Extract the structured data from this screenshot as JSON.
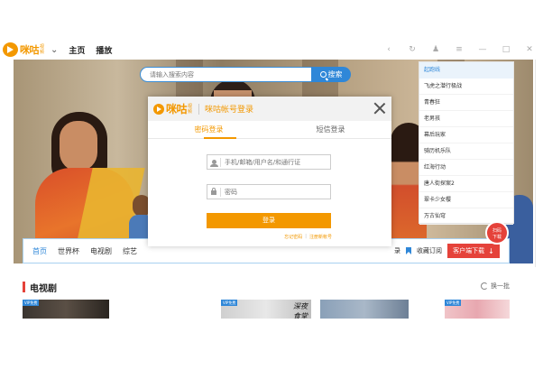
{
  "titlebar": {
    "logo_text": "咪咕",
    "logo_sub": "视频",
    "nav": [
      "主页",
      "播放"
    ],
    "icons": [
      "back-icon",
      "refresh-icon",
      "user-icon",
      "menu-icon",
      "minimize-icon",
      "maximize-icon",
      "close-icon"
    ]
  },
  "search": {
    "placeholder": "请输入搜索内容",
    "button_label": "搜索"
  },
  "rank_list": {
    "head": "起跑线",
    "items": [
      "飞虎之潜行极战",
      "青春狂",
      "老男孩",
      "幕后玩家",
      "骑历机乐队",
      "红海行动",
      "唐人街探案2",
      "翠卡少女樱",
      "万古仙穹"
    ]
  },
  "float_download": {
    "line1": "扫码",
    "line2": "下载"
  },
  "categories": {
    "items": [
      "首页",
      "世界杯",
      "电视剧",
      "综艺"
    ],
    "tail": "录",
    "favorite": "收藏订阅",
    "client_download": "客户端下载"
  },
  "section": {
    "title": "电视剧",
    "refresh": "换一批",
    "vip_badge": "VIP免费",
    "thumb_title": "深夜食堂"
  },
  "modal": {
    "logo_text": "咪咕",
    "logo_sub": "视频",
    "title": "咪咕帐号登录",
    "tabs": [
      "密码登录",
      "短信登录"
    ],
    "username_placeholder": "手机/邮箱/用户名/和通行证",
    "password_placeholder": "密码",
    "login_button": "登录",
    "forgot": "忘记密码",
    "register": "注册新帐号"
  },
  "colors": {
    "brand_orange": "#f39800",
    "accent_blue": "#2f87d8",
    "download_red": "#e5423a"
  }
}
